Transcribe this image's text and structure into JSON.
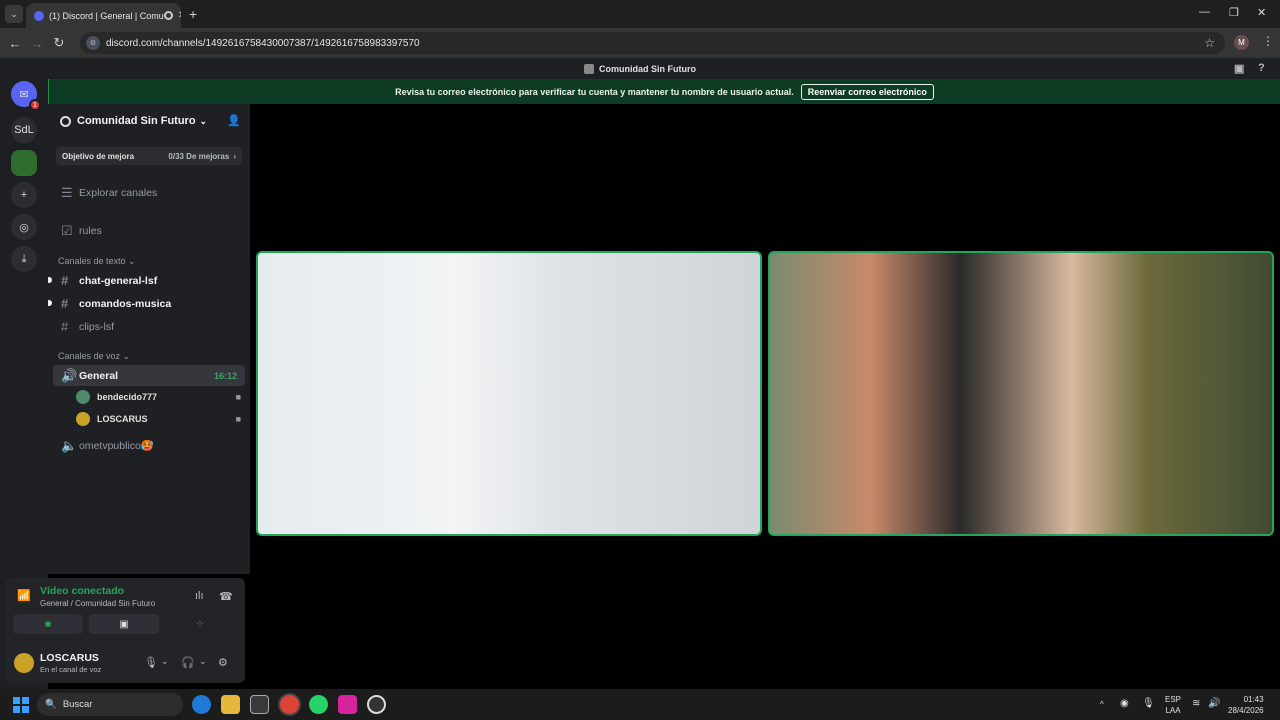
{
  "browser": {
    "tab_title": "(1) Discord | General | Comu",
    "url": "discord.com/channels/1492616758430007387/1492616758983397570",
    "profile_initial": "M"
  },
  "app_title": "Comunidad Sin Futuro",
  "notice": {
    "text": "Revisa tu correo electrónico para verificar tu cuenta y mantener tu nombre de usuario actual.",
    "button": "Reenviar correo electrónico"
  },
  "rail": {
    "dm_badge": "1",
    "server_abbrev": "SdL"
  },
  "server": {
    "name": "Comunidad Sin Futuro",
    "boost_label": "Objetivo de mejora",
    "boost_value": "0/33 De mejoras"
  },
  "channels": {
    "browse": "Explorar canales",
    "rules": "rules",
    "text_category": "Canales de texto",
    "text_channels": [
      "chat-general-lsf",
      "comandos-musica",
      "clips-lsf"
    ],
    "voice_category": "Canales de voz",
    "active_voice": "General",
    "active_time": "16:12",
    "members": [
      "bendecido777",
      "LOSCARUS"
    ],
    "other_voice": "ometvpublico🥵"
  },
  "voice_panel": {
    "status": "Vídeo conectado",
    "location": "General / Comunidad Sin Futuro",
    "username": "LOSCARUS",
    "user_status": "En el canal de voz"
  },
  "taskbar": {
    "search": "Buscar",
    "lang_top": "ESP",
    "lang_bottom": "LAA",
    "time": "01:43",
    "date": "28/4/2026"
  }
}
